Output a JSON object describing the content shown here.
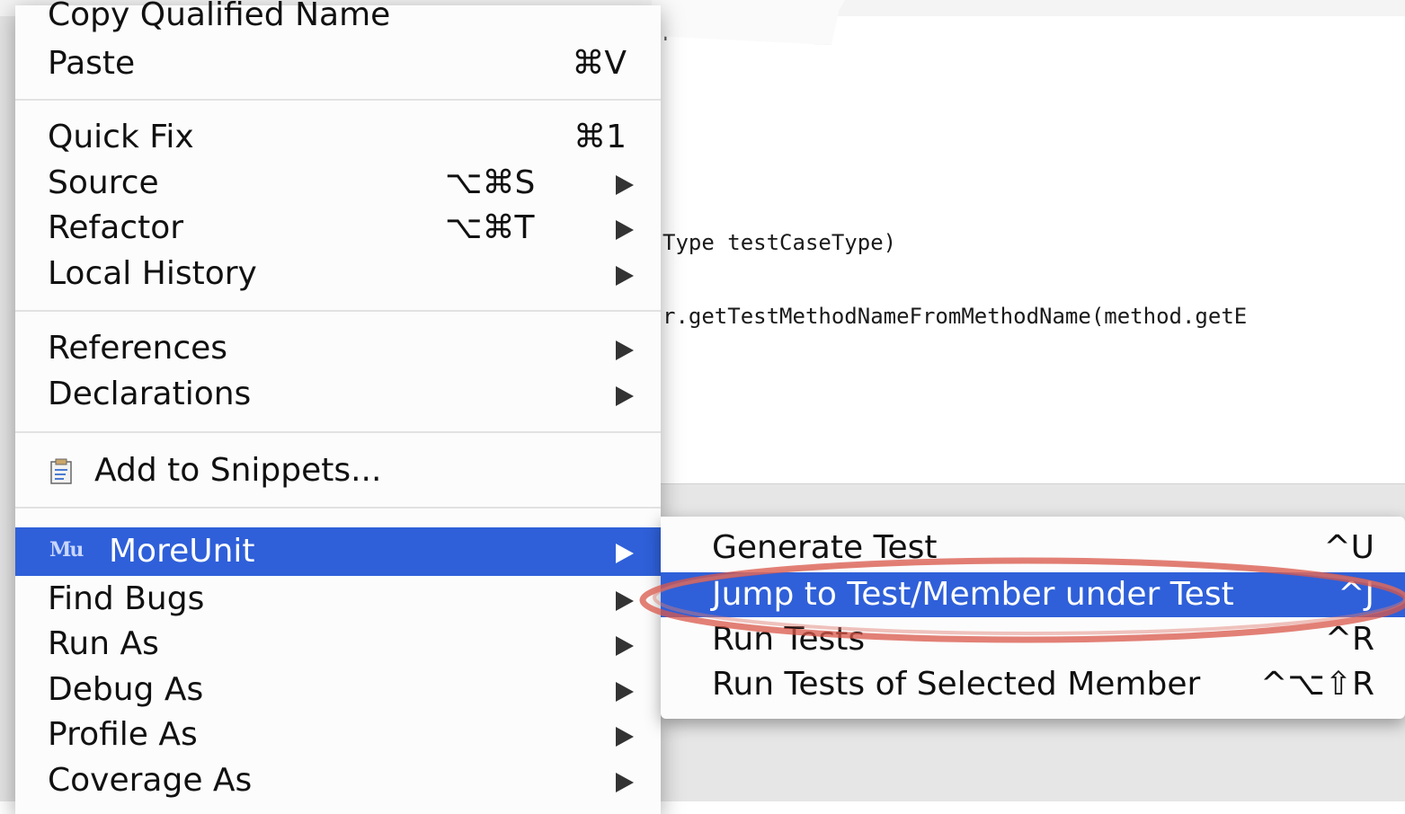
{
  "editor": {
    "code_line_top": "pen();",
    "code_line_1": "Type testCaseType)",
    "code_line_2": "r.getTestMethodNameFromMethodName(method.getE"
  },
  "context_menu": {
    "items": [
      {
        "label": "Copy Qualified Name",
        "shortcut": ""
      },
      {
        "label": "Paste",
        "shortcut": "⌘V"
      },
      {
        "label": "Quick Fix",
        "shortcut": "⌘1"
      },
      {
        "label": "Source",
        "shortcut": "⌥⌘S",
        "submenu": true
      },
      {
        "label": "Refactor",
        "shortcut": "⌥⌘T",
        "submenu": true
      },
      {
        "label": "Local History",
        "submenu": true
      },
      {
        "label": "References",
        "submenu": true
      },
      {
        "label": "Declarations",
        "submenu": true
      },
      {
        "label": "Add to Snippets...",
        "icon": "snippet-icon"
      },
      {
        "label": "MoreUnit",
        "submenu": true,
        "selected": true,
        "icon": "moreunit-icon",
        "icon_text": "Mu"
      },
      {
        "label": "Find Bugs",
        "submenu": true
      },
      {
        "label": "Run As",
        "submenu": true
      },
      {
        "label": "Debug As",
        "submenu": true
      },
      {
        "label": "Profile As",
        "submenu": true
      },
      {
        "label": "Coverage As",
        "submenu": true
      }
    ]
  },
  "submenu": {
    "items": [
      {
        "label": "Generate Test",
        "shortcut": "^U"
      },
      {
        "label": "Jump to Test/Member under Test",
        "shortcut": "^J",
        "selected": true
      },
      {
        "label": "Run Tests",
        "shortcut": "^R"
      },
      {
        "label": "Run Tests of Selected Member",
        "shortcut": "^⌥⇧R"
      }
    ]
  },
  "colors": {
    "selection": "#2f60d9",
    "annotation": "#d9574a"
  }
}
